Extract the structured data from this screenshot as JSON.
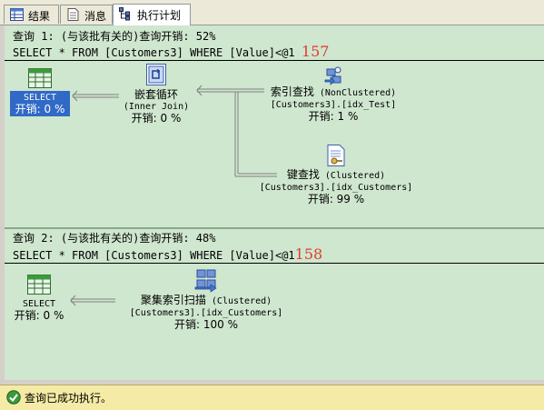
{
  "tabs": [
    {
      "label": "结果",
      "icon": "grid-icon"
    },
    {
      "label": "消息",
      "icon": "document-icon"
    },
    {
      "label": "执行计划",
      "icon": "execution-plan-icon"
    }
  ],
  "query1": {
    "header": "查询 1: (与该批有关的)查询开销: 52%",
    "sql": "SELECT * FROM [Customers3] WHERE [Value]<@1",
    "annotation": "157",
    "nodes": {
      "select": {
        "name": "SELECT",
        "cost": "开销: 0 %"
      },
      "nested_loops": {
        "name": "嵌套循环",
        "detail": "(Inner Join)",
        "cost": "开销: 0 %"
      },
      "index_seek": {
        "name": "索引查找",
        "detail": "(NonClustered)",
        "object": "[Customers3].[idx_Test]",
        "cost": "开销: 1 %"
      },
      "key_lookup": {
        "name": "键查找",
        "detail": "(Clustered)",
        "object": "[Customers3].[idx_Customers]",
        "cost": "开销: 99 %"
      }
    }
  },
  "query2": {
    "header": "查询 2: (与该批有关的)查询开销: 48%",
    "sql": "SELECT * FROM [Customers3] WHERE [Value]<@1",
    "annotation": "158",
    "nodes": {
      "select": {
        "name": "SELECT",
        "cost": "开销: 0 %"
      },
      "clustered_scan": {
        "name": "聚集索引扫描",
        "detail": "(Clustered)",
        "object": "[Customers3].[idx_Customers]",
        "cost": "开销: 100 %"
      }
    }
  },
  "status": {
    "text": "查询已成功执行。",
    "icon": "success-check-icon"
  },
  "colors": {
    "plan_background": "#cfe6cf",
    "selected": "#3169c6",
    "status_bar": "#f5eba6",
    "annotation": "#e23b2e"
  }
}
